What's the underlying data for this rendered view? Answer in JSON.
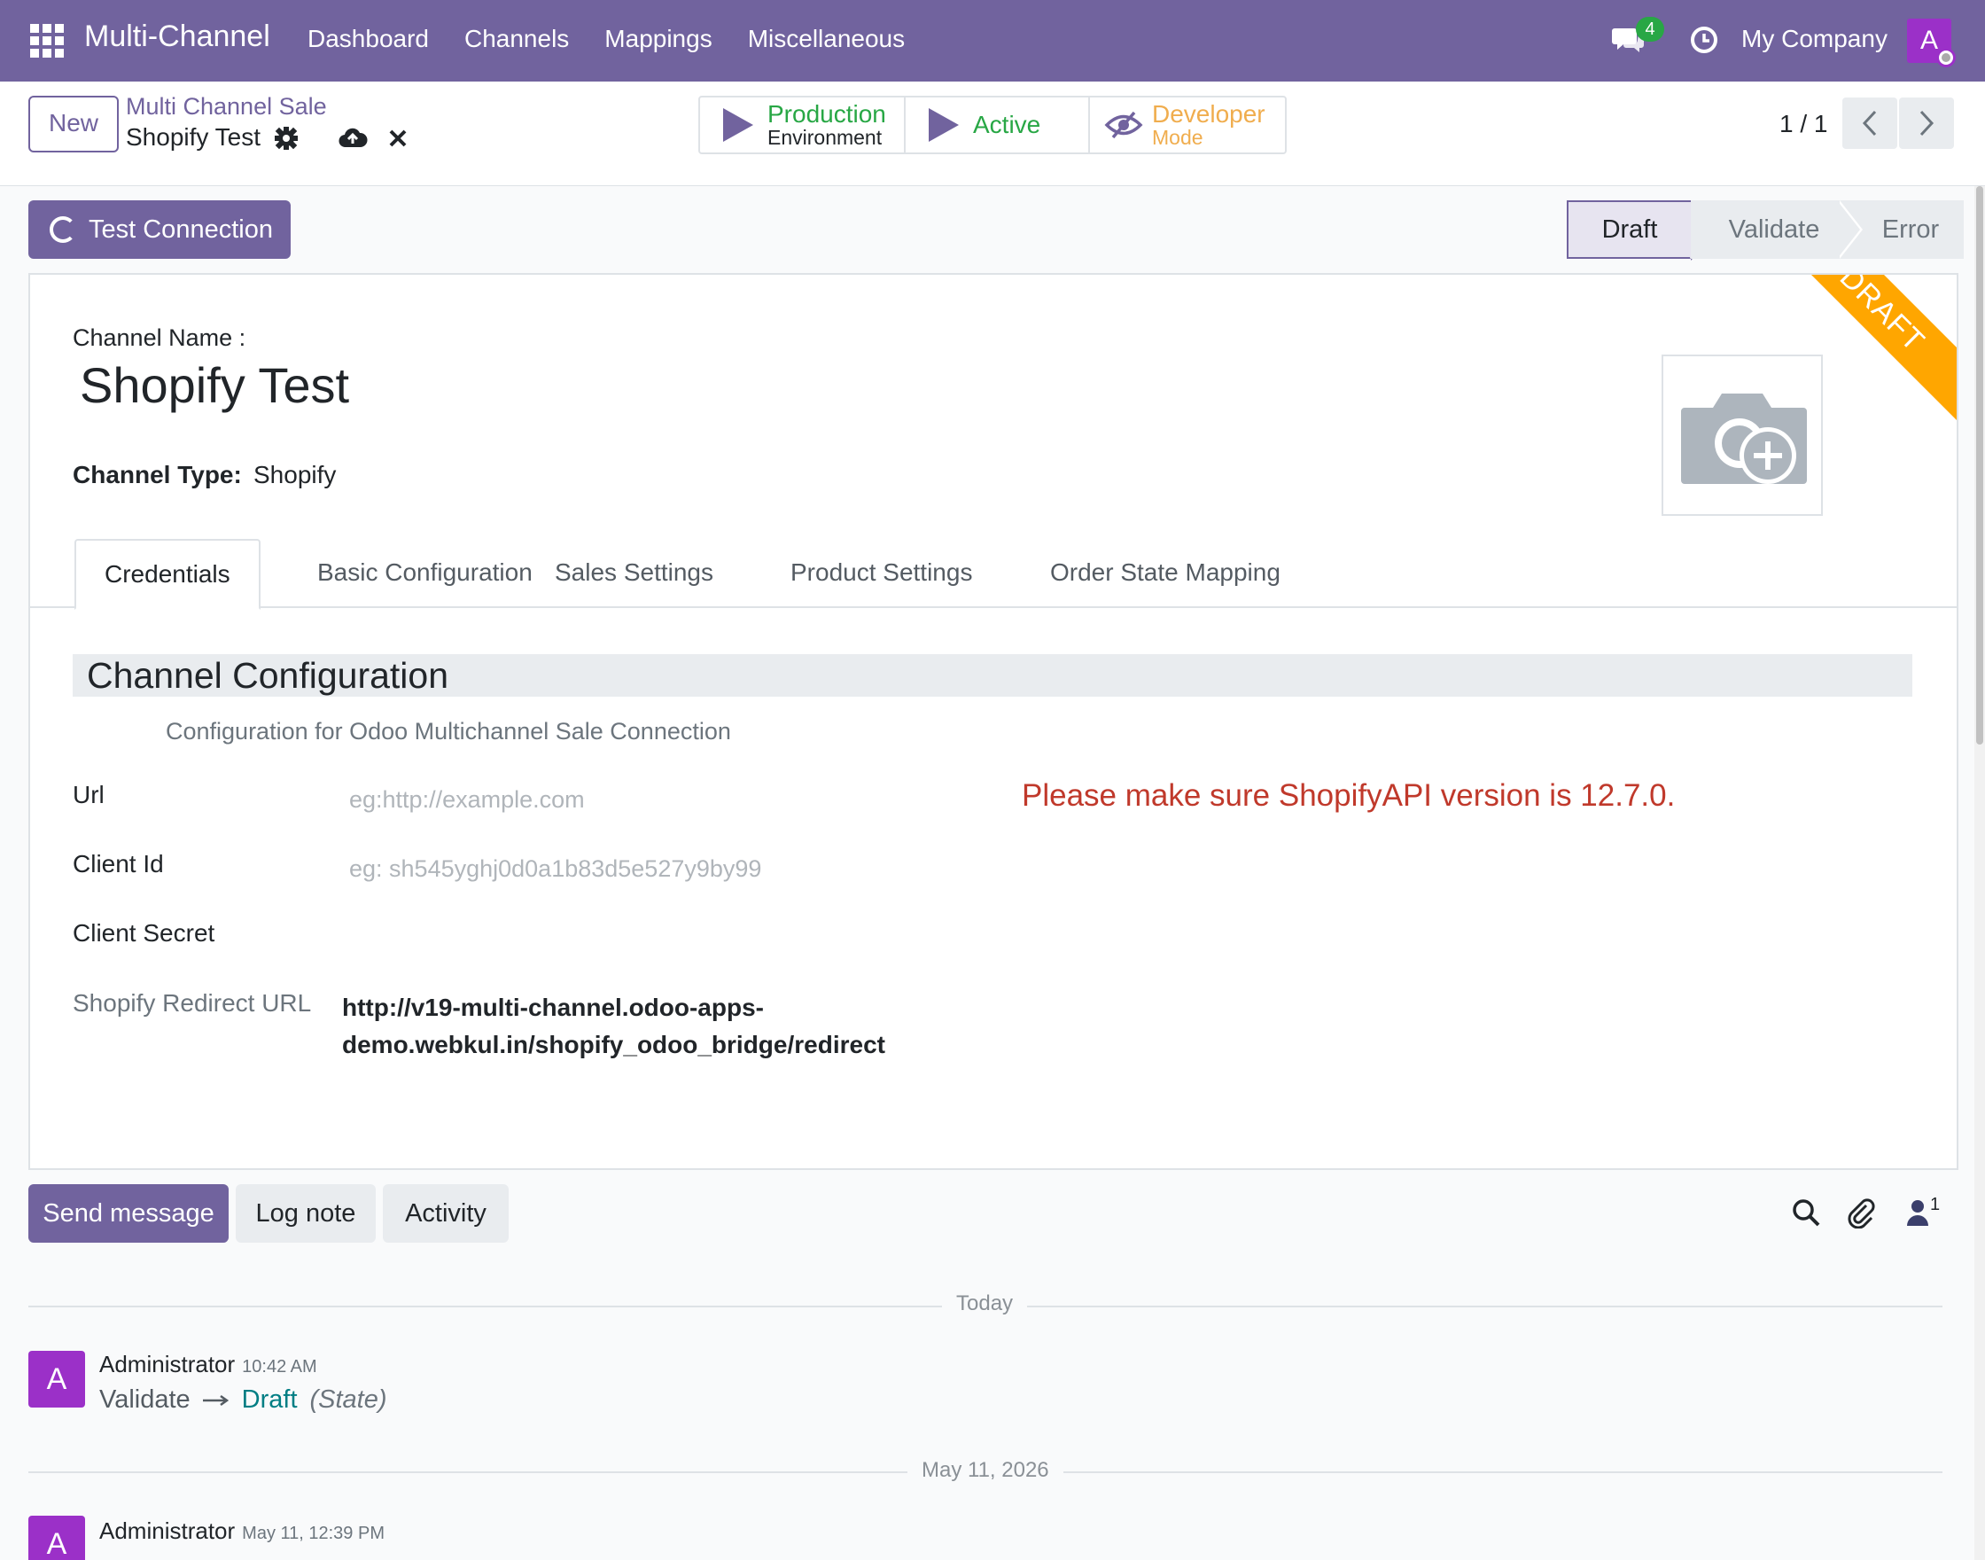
{
  "navbar": {
    "brand": "Multi-Channel",
    "menu": [
      "Dashboard",
      "Channels",
      "Mappings",
      "Miscellaneous"
    ],
    "chat_count": "4",
    "company": "My Company",
    "user_initial": "A"
  },
  "control": {
    "new_label": "New",
    "breadcrumb_parent": "Multi Channel Sale",
    "breadcrumb_current": "Shopify Test",
    "pager": "1 / 1",
    "smart_buttons": {
      "production_line1": "Production",
      "production_line2": "Environment",
      "active": "Active",
      "developer_line1": "Developer",
      "developer_line2": "Mode"
    }
  },
  "actions": {
    "test_connection": "Test Connection"
  },
  "statusbar": {
    "stages": [
      "Draft",
      "Validate",
      "Error"
    ],
    "current": "Draft"
  },
  "form": {
    "ribbon": "DRAFT",
    "channel_name_label": "Channel Name :",
    "channel_name": "Shopify Test",
    "channel_type_label": "Channel Type:",
    "channel_type": "Shopify",
    "tabs": [
      "Credentials",
      "Basic Configuration",
      "Sales Settings",
      "Product Settings",
      "Order State Mapping"
    ],
    "active_tab": "Credentials",
    "section_title": "Channel Configuration",
    "section_desc": "Configuration for Odoo Multichannel Sale Connection",
    "url_label": "Url",
    "url_placeholder": "eg:http://example.com",
    "client_id_label": "Client Id",
    "client_id_placeholder": "eg: sh545yghj0d0a1b83d5e527y9by99",
    "client_secret_label": "Client Secret",
    "warning": "Please make sure ShopifyAPI version is 12.7.0.",
    "redirect_label": "Shopify Redirect URL",
    "redirect_line1": "http://v19-multi-channel.odoo-apps-",
    "redirect_line2": "demo.webkul.in/shopify_odoo_bridge/redirect"
  },
  "chatter": {
    "send_message": "Send message",
    "log_note": "Log note",
    "activity": "Activity",
    "followers_count": "1",
    "date_sep_1": "Today",
    "date_sep_2": "May 11, 2026",
    "messages": [
      {
        "initial": "A",
        "author": "Administrator",
        "time": "10:42 AM",
        "old_value": "Validate",
        "new_value": "Draft",
        "field": "(State)"
      },
      {
        "initial": "A",
        "author": "Administrator",
        "time": "May 11, 12:39 PM"
      }
    ]
  },
  "colors": {
    "brand": "#71639e",
    "ribbon": "#ffa600",
    "warning": "#c0392b",
    "success": "#28a745",
    "dev_mode": "#f0ad4e"
  }
}
